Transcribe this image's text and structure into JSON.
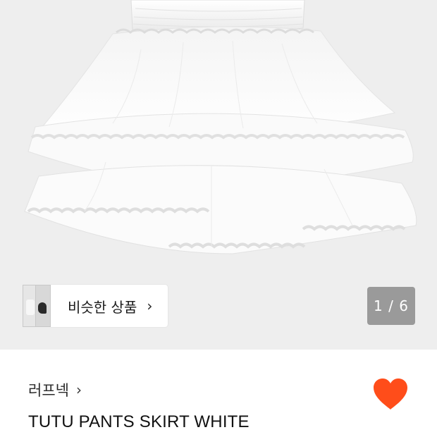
{
  "product": {
    "image_alt": "TUTU PANTS SKIRT WHITE",
    "similar_label": "비슷한 상품",
    "similar_chevron": "›",
    "image_counter": "1 / 6",
    "brand": "러프넥",
    "brand_chevron": "›",
    "name": "TUTU PANTS SKIRT WHITE",
    "wishlisted": true
  },
  "colors": {
    "heart": "#ff4d1a",
    "counter_bg": "#9a9a9a",
    "hero_bg": "#eeeeee"
  },
  "icons": {
    "similar_chevron": "chevron-right-icon",
    "brand_chevron": "chevron-right-icon",
    "wishlist": "heart-icon"
  }
}
